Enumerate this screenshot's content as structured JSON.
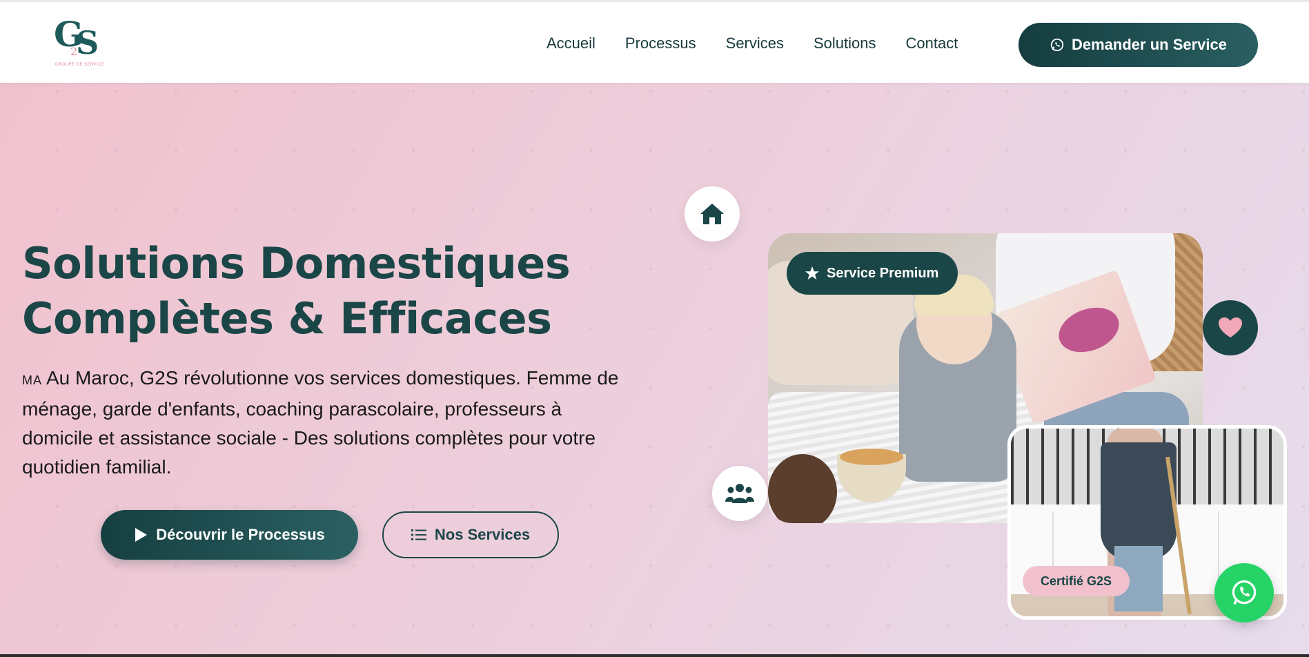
{
  "brand": {
    "logo_main": "GS",
    "logo_two": "2",
    "logo_sub": "GROUPE DE SERVICE",
    "accent_color": "#1b4647",
    "pink_color": "#f1c2cd",
    "whatsapp_color": "#25d366"
  },
  "nav": {
    "items": [
      {
        "label": "Accueil"
      },
      {
        "label": "Processus"
      },
      {
        "label": "Services"
      },
      {
        "label": "Solutions"
      },
      {
        "label": "Contact"
      }
    ],
    "cta_label": "Demander un Service",
    "cta_icon": "whatsapp-icon"
  },
  "hero": {
    "title_line1": "Solutions Domestiques",
    "title_line2": "Complètes & Efficaces",
    "flag_code": "MA",
    "description": "Au Maroc, G2S révolutionne vos services domestiques. Femme de ménage, garde d'enfants, coaching parascolaire, professeurs à domicile et assistance sociale - Des solutions complètes pour votre quotidien familial.",
    "primary_button": "Découvrir le Processus",
    "secondary_button": "Nos Services"
  },
  "badges": {
    "premium": "Service Premium",
    "certified": "Certifié G2S"
  },
  "icons": {
    "home": "home-icon",
    "users": "users-icon",
    "heart": "heart-icon",
    "star": "star-icon",
    "play": "play-icon",
    "list": "list-icon"
  }
}
